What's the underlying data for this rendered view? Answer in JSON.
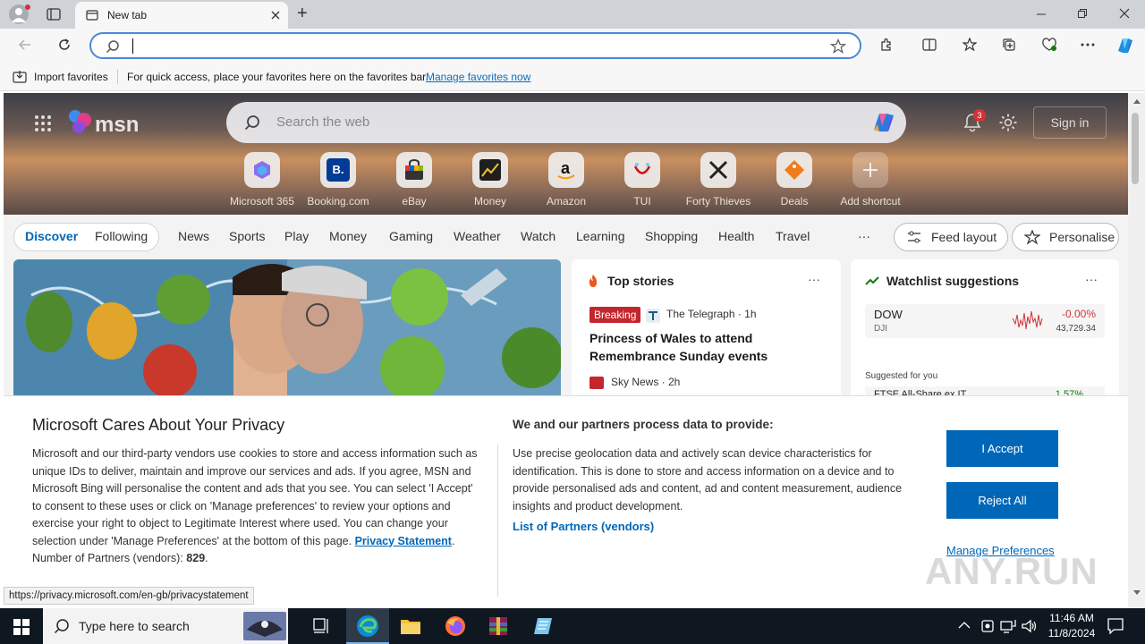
{
  "browser": {
    "tab_title": "New tab",
    "new_tab_symbol": "+",
    "address_value": "",
    "favorites_bar": {
      "import_label": "Import favorites",
      "message": "For quick access, place your favorites here on the favorites bar.",
      "manage_link": "Manage favorites now"
    },
    "status_url": "https://privacy.microsoft.com/en-gb/privacystatement"
  },
  "msn": {
    "logo_text": "msn",
    "search_placeholder": "Search the web",
    "notification_count": "3",
    "sign_in_label": "Sign in",
    "shortcuts": [
      {
        "label": "Microsoft 365",
        "icon": "microsoft-365-icon"
      },
      {
        "label": "Booking.com",
        "icon": "booking-icon"
      },
      {
        "label": "eBay",
        "icon": "ebay-icon"
      },
      {
        "label": "Money",
        "icon": "money-icon"
      },
      {
        "label": "Amazon",
        "icon": "amazon-icon"
      },
      {
        "label": "TUI",
        "icon": "tui-icon"
      },
      {
        "label": "Forty Thieves",
        "icon": "forty-thieves-icon"
      },
      {
        "label": "Deals",
        "icon": "deals-icon"
      },
      {
        "label": "Add shortcut",
        "icon": "plus-icon"
      }
    ],
    "nav": {
      "discover": "Discover",
      "following": "Following",
      "items": [
        "News",
        "Sports",
        "Play",
        "Money",
        "Gaming",
        "Weather",
        "Watch",
        "Learning",
        "Shopping",
        "Health",
        "Travel"
      ],
      "more": "···",
      "feed_layout": "Feed layout",
      "personalise": "Personalise"
    },
    "top_stories": {
      "title": "Top stories",
      "more": "···",
      "badge": "Breaking",
      "source1": "The Telegraph · 1h",
      "headline1": "Princess of Wales to attend Remembrance Sunday events",
      "source2": "Sky News · 2h"
    },
    "watchlist": {
      "title": "Watchlist suggestions",
      "more": "···",
      "symbol": "DOW",
      "sub": "DJI",
      "change": "-0.00%",
      "price": "43,729.34",
      "suggested": "Suggested for you",
      "next_symbol": "FTSE All-Share ex IT",
      "next_change": "1.57%"
    }
  },
  "privacy": {
    "title": "Microsoft Cares About Your Privacy",
    "body": "Microsoft and our third-party vendors use cookies to store and access information such as unique IDs to deliver, maintain and improve our services and ads. If you agree, MSN and Microsoft Bing will personalise the content and ads that you see. You can select 'I Accept' to consent to these uses or click on 'Manage preferences' to review your options and exercise your right to object to Legitimate Interest where used.  You can change your selection under 'Manage Preferences' at the bottom of this page.",
    "privacy_link": "Privacy Statement",
    "partners_label": "Number of Partners (vendors):",
    "partners_count": "829",
    "data_title": "We and our partners process data to provide:",
    "data_body": "Use precise geolocation data and actively scan device characteristics for identification. This is done to store and access information on a device and to provide personalised ads and content, ad and content measurement, audience insights and product development.",
    "list_link": "List of Partners (vendors)",
    "accept": "I Accept",
    "reject": "Reject All",
    "manage": "Manage Preferences"
  },
  "taskbar": {
    "search_placeholder": "Type here to search",
    "time": "11:46 AM",
    "date": "11/8/2024"
  },
  "watermark": "ANY.RUN",
  "colors": {
    "accent": "#0067b8",
    "breaking": "#c4262e",
    "negative": "#d13438",
    "positive": "#107c10"
  }
}
